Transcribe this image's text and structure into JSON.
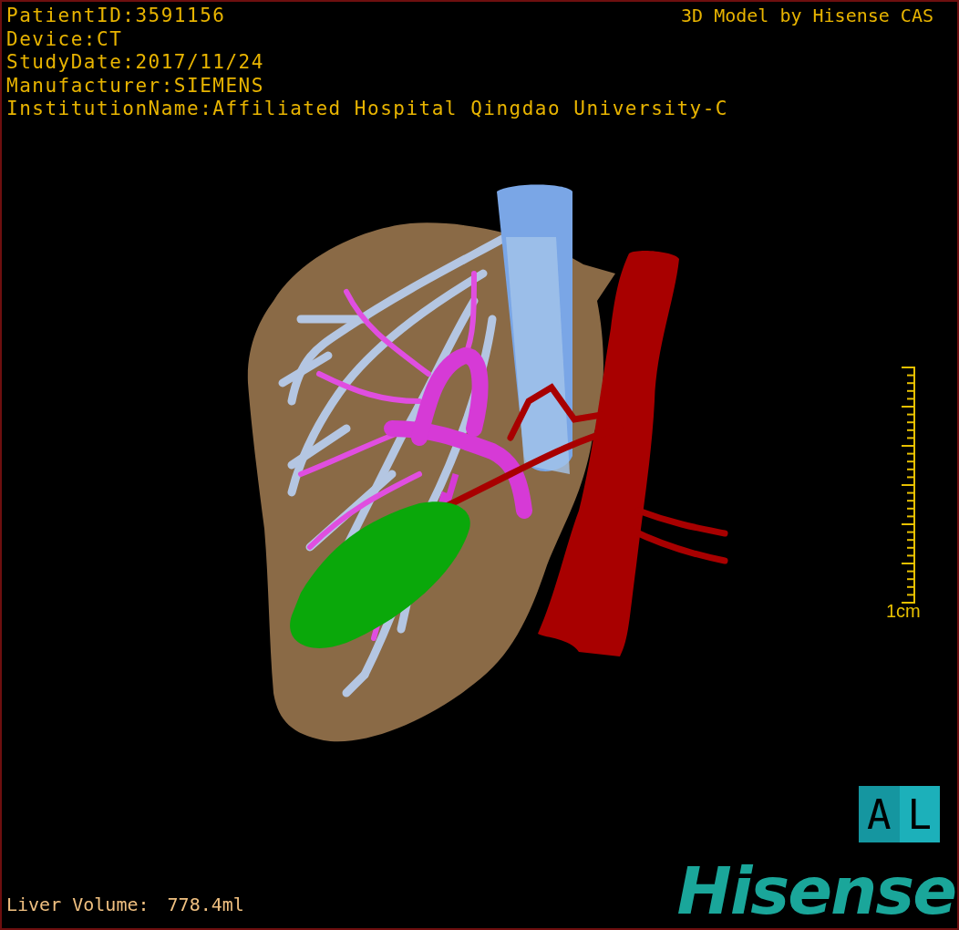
{
  "patient_info": [
    "PatientID:3591156",
    "Device:CT",
    "StudyDate:2017/11/24",
    "Manufacturer:SIEMENS",
    "InstitutionName:Affiliated Hospital Qingdao University-C"
  ],
  "title": "3D Model by Hisense CAS",
  "scale_bar": {
    "label": "1cm"
  },
  "orientation_cube": {
    "faces": [
      "A",
      "L"
    ]
  },
  "liver_volume": {
    "label": "Liver Volume:",
    "value": "778.4ml"
  },
  "logo": "Hisense"
}
